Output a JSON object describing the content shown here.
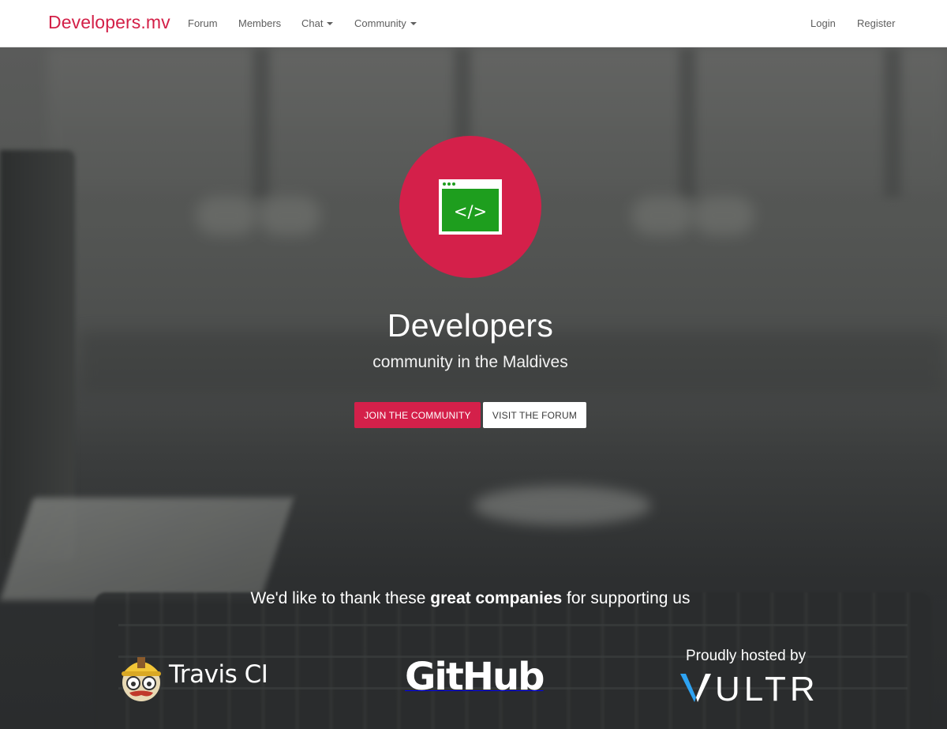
{
  "navbar": {
    "brand": "Developers.mv",
    "links": {
      "forum": "Forum",
      "members": "Members",
      "chat": "Chat",
      "community": "Community",
      "login": "Login",
      "register": "Register"
    }
  },
  "hero": {
    "title": "Developers",
    "subtitle": "community in the Maldives",
    "join_button": "JOIN THE COMMUNITY",
    "forum_button": "VISIT THE FORUM",
    "logo_icon": "code-window-icon",
    "logo_code_text": "</>"
  },
  "sponsors": {
    "thanks_prefix": "We'd like to thank these ",
    "thanks_bold": "great companies",
    "thanks_suffix": " for supporting us",
    "travis": "Travis CI",
    "github": "GitHub",
    "vultr_caption": "Proudly hosted by",
    "vultr": "VULTR"
  },
  "colors": {
    "brand": "#d31f47",
    "accent": "#d4204a",
    "code_green": "#1e9e1e",
    "vultr_blue": "#2ea3f2"
  }
}
